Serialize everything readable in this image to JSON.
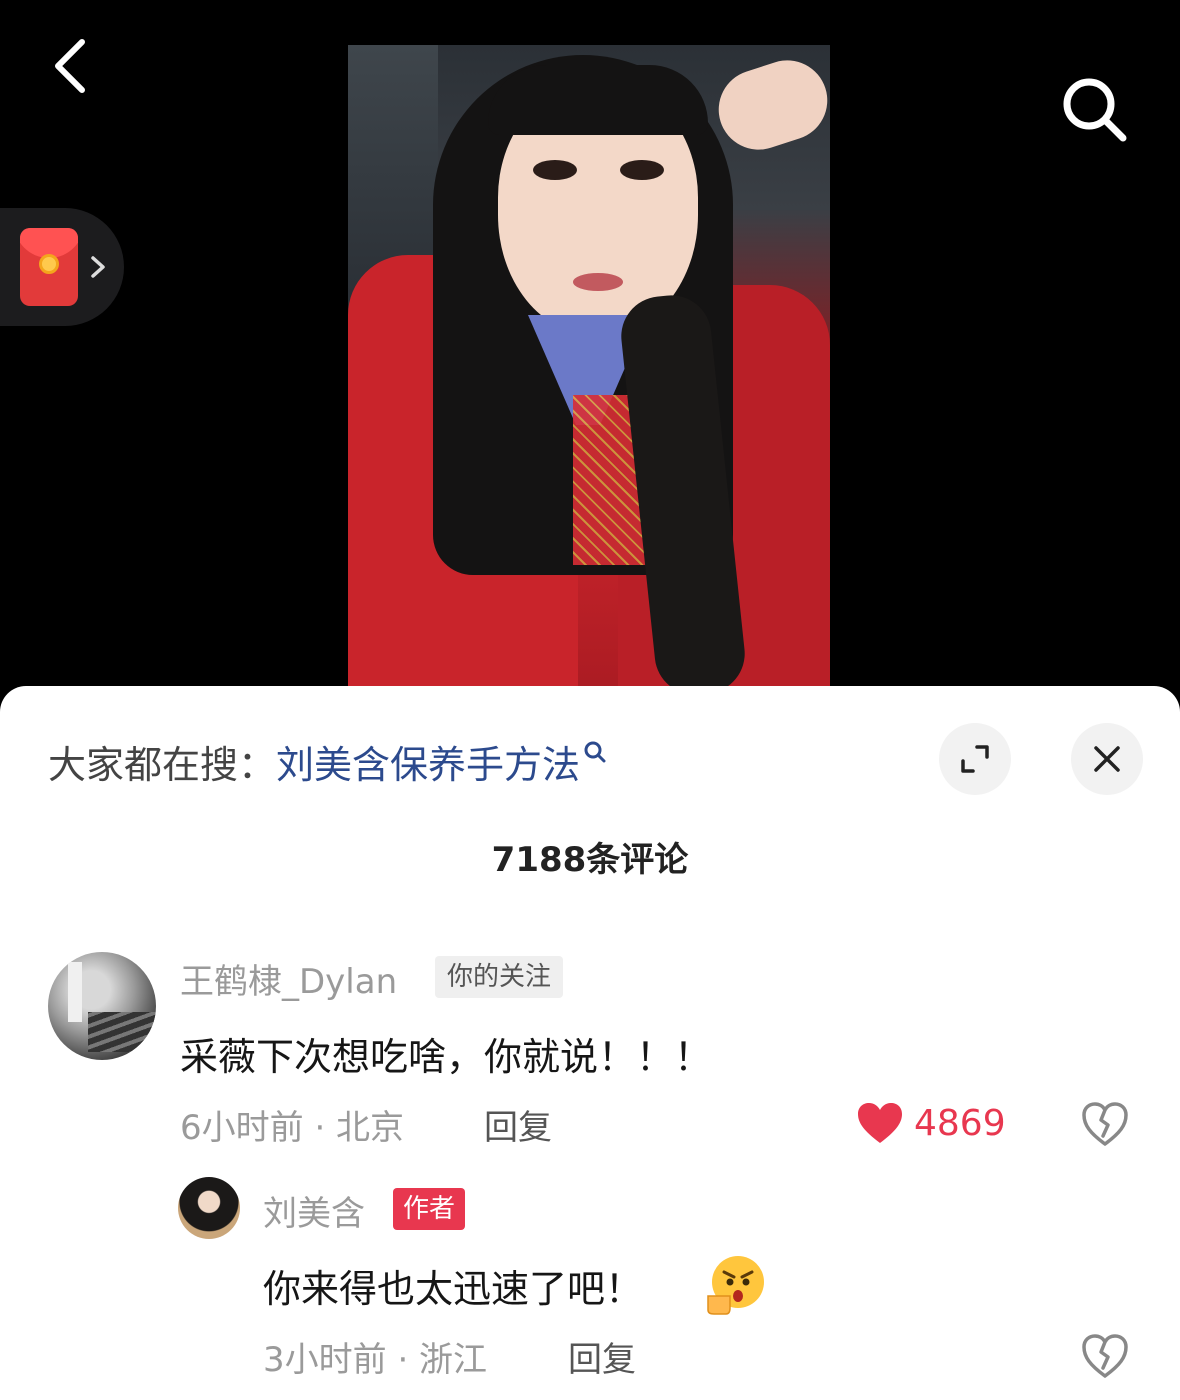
{
  "video": {
    "back_icon": "chevron-left-icon",
    "search_icon": "search-icon",
    "redpacket_icon": "red-envelope-icon"
  },
  "sheet": {
    "trend_prefix": "大家都在搜：",
    "trend_keyword": "刘美含保养手方法",
    "comment_count": "7188条评论"
  },
  "comments": [
    {
      "username": "王鹤棣_Dylan",
      "tag": "你的关注",
      "text": "采薇下次想吃啥，你就说！！！",
      "meta": "6小时前 · 北京",
      "reply": "回复",
      "likes": "4869",
      "liked": true
    },
    {
      "username": "刘美含",
      "tag": "作者",
      "text": "你来得也太迅速了吧！",
      "meta": "3小时前 · 浙江",
      "reply": "回复"
    }
  ],
  "colors": {
    "keyword": "#2c4a8d",
    "like": "#e8374f",
    "author_tag": "#e8374f"
  }
}
